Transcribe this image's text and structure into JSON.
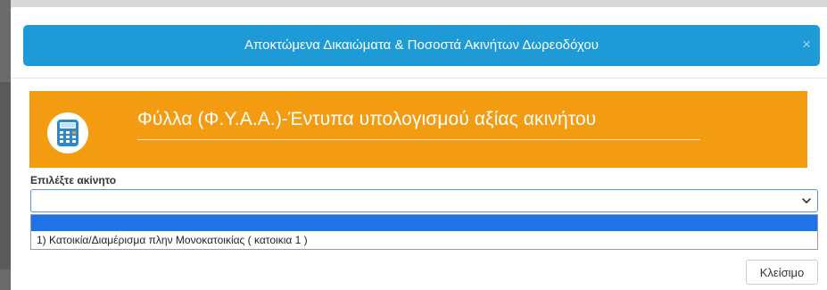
{
  "dialog": {
    "title": "Αποκτώμενα Δικαιώματα & Ποσοστά Ακινήτων Δωρεοδόχου",
    "close_symbol": "×",
    "header_color": "#1e9ad6"
  },
  "banner": {
    "title": "Φύλλα (Φ.Υ.Α.Α.)-Έντυπα υπολογισμού αξίας ακινήτου",
    "icon": "calculator-icon",
    "color": "#f39c12"
  },
  "property_select": {
    "label": "Επιλέξτε ακίνητο",
    "selected_value": "",
    "options": [
      "",
      "1) Κατοικία/Διαμέρισμα πλην Μονοκατοικίας ( κατοικια 1 )"
    ],
    "highlight_color": "#1e73e8"
  },
  "footer": {
    "close_label": "Κλείσιμο"
  }
}
